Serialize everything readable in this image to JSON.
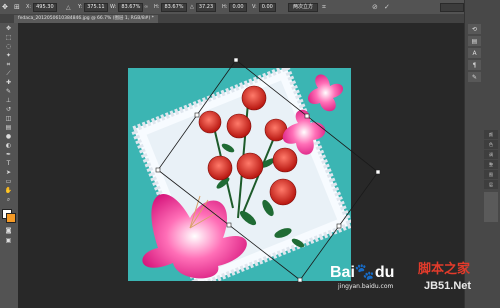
{
  "options_bar": {
    "x_value": "495.30",
    "y_value": "375.11",
    "w_value": "83.67%",
    "h_value": "83.67%",
    "angle_value": "37.23",
    "h_skew": "0.00",
    "v_skew": "0.00",
    "interpolation": "两次立方"
  },
  "document_tab": {
    "label": "fedaca_2012050610384846.jpg @ 66.7% (图层 1, RGB/8#) *"
  },
  "right_panel": {
    "labels": [
      "颜",
      "色",
      "调",
      "整",
      "图",
      "层"
    ]
  },
  "watermark": {
    "baidu_text": "Bai",
    "baidu_du": "du",
    "jingyan_text": "jingyan.baidu.com",
    "jb51_cn": "脚本之家",
    "jb51_en": "JB51.Net"
  },
  "colors": {
    "foreground": "#f59a26",
    "background": "#ffffff"
  }
}
